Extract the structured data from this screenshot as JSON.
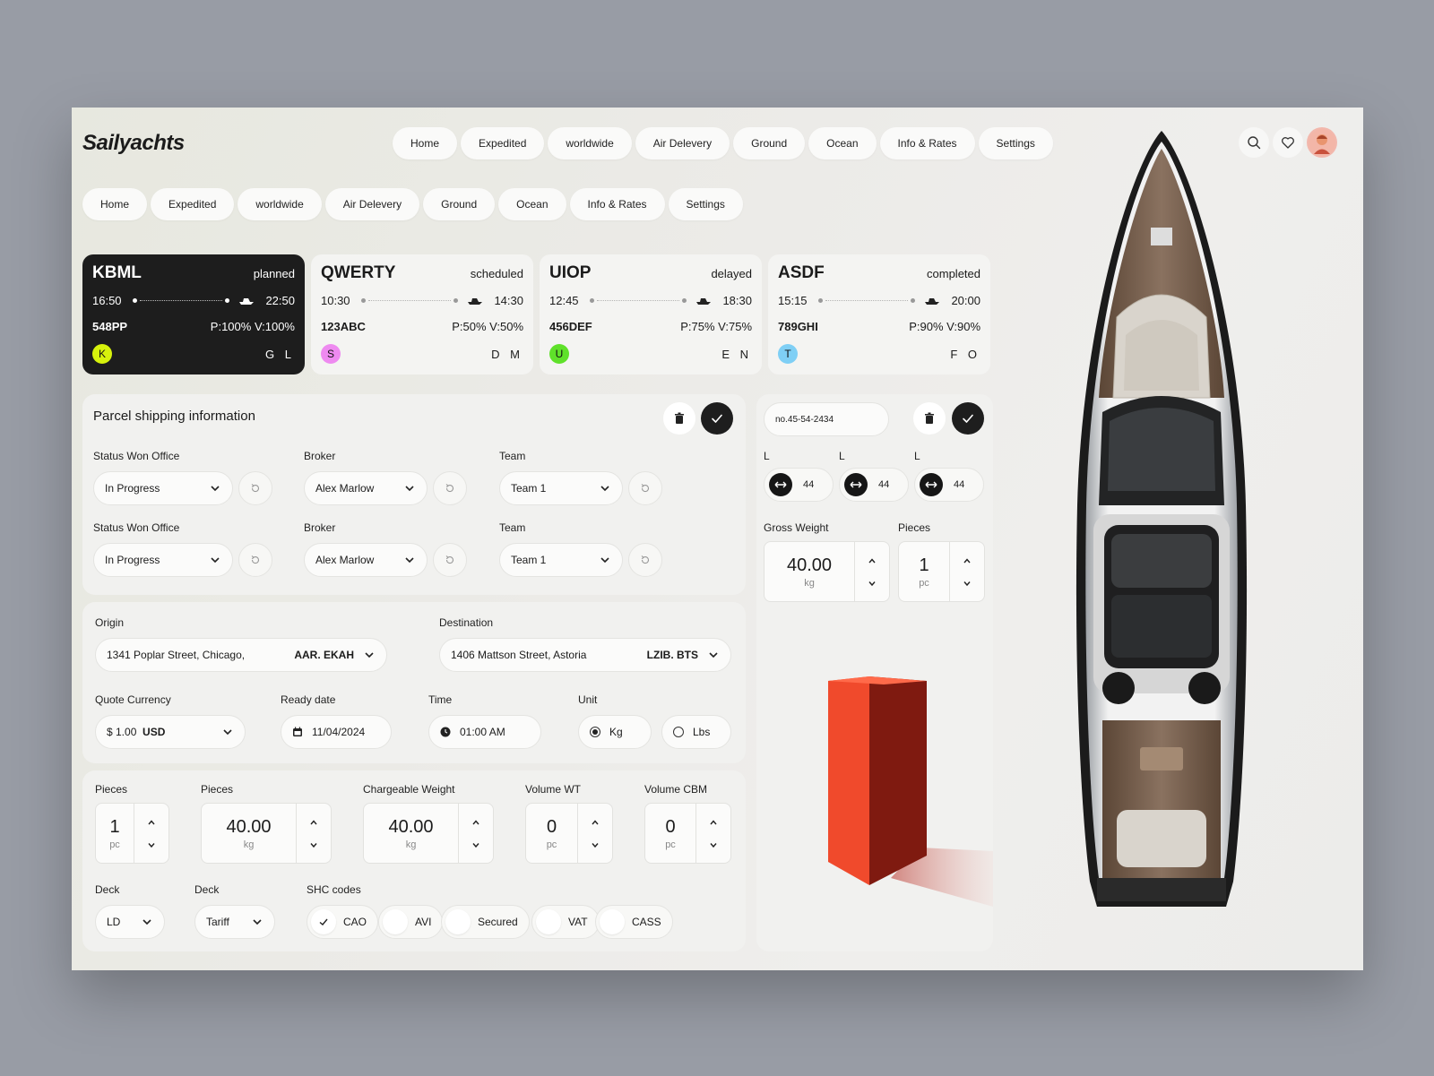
{
  "app": {
    "title": "Sailyachts"
  },
  "nav_top": [
    "Home",
    "Expedited",
    "worldwide",
    "Air Delevery",
    "Ground",
    "Ocean",
    "Info & Rates",
    "Settings"
  ],
  "nav_second": [
    "Home",
    "Expedited",
    "worldwide",
    "Air Delevery",
    "Ground",
    "Ocean",
    "Info & Rates",
    "Settings"
  ],
  "cards": [
    {
      "code": "KBML",
      "status": "planned",
      "dep": "16:50",
      "arr": "22:50",
      "id": "548PP",
      "pv": "P:100%  V:100%",
      "avatar": "K",
      "avatar_color": "#d7f20c",
      "letters": "G L"
    },
    {
      "code": "QWERTY",
      "status": "scheduled",
      "dep": "10:30",
      "arr": "14:30",
      "id": "123ABC",
      "pv": "P:50%  V:50%",
      "avatar": "S",
      "avatar_color": "#ee8af0",
      "letters": "D M"
    },
    {
      "code": "UIOP",
      "status": "delayed",
      "dep": "12:45",
      "arr": "18:30",
      "id": "456DEF",
      "pv": "P:75%  V:75%",
      "avatar": "U",
      "avatar_color": "#5fe12a",
      "letters": "E N"
    },
    {
      "code": "ASDF",
      "status": "completed",
      "dep": "15:15",
      "arr": "20:00",
      "id": "789GHI",
      "pv": "P:90%  V:90%",
      "avatar": "T",
      "avatar_color": "#7fcff5",
      "letters": "F O"
    }
  ],
  "parcel": {
    "title": "Parcel shipping information",
    "rows": [
      {
        "status_label": "Status Won Office",
        "status_value": "In Progress",
        "broker_label": "Broker",
        "broker_value": "Alex Marlow",
        "team_label": "Team",
        "team_value": "Team 1"
      },
      {
        "status_label": "Status Won Office",
        "status_value": "In Progress",
        "broker_label": "Broker",
        "broker_value": "Alex Marlow",
        "team_label": "Team",
        "team_value": "Team 1"
      }
    ]
  },
  "route": {
    "origin_label": "Origin",
    "origin_value": "1341 Poplar Street, Chicago,",
    "origin_code": "AAR. EKAH",
    "dest_label": "Destination",
    "dest_value": "1406 Mattson Street, Astoria",
    "dest_code": "LZIB. BTS",
    "currency_label": "Quote Currency",
    "currency_amount": "$ 1.00",
    "currency_code": "USD",
    "ready_label": "Ready date",
    "ready_value": "11/04/2024",
    "time_label": "Time",
    "time_value": "01:00 AM",
    "unit_label": "Unit",
    "unit_kg": "Kg",
    "unit_lbs": "Lbs"
  },
  "measures": {
    "pieces1_label": "Pieces",
    "pieces1_value": "1",
    "pieces1_unit": "pc",
    "pieces2_label": "Pieces",
    "pieces2_value": "40.00",
    "pieces2_unit": "kg",
    "charge_label": "Chargeable Weight",
    "charge_value": "40.00",
    "charge_unit": "kg",
    "vwt_label": "Volume WT",
    "vwt_value": "0",
    "vwt_unit": "pc",
    "vcbm_label": "Volume CBM",
    "vcbm_value": "0",
    "vcbm_unit": "pc",
    "deck1_label": "Deck",
    "deck1_value": "LD",
    "deck2_label": "Deck",
    "deck2_value": "Tariff",
    "shc_label": "SHC codes",
    "shc": [
      "CAO",
      "AVI",
      "Secured",
      "VAT",
      "CASS"
    ]
  },
  "side": {
    "ref": "no.45-54-2434",
    "dim_labels": [
      "L",
      "L",
      "L"
    ],
    "dim_values": [
      "44",
      "44",
      "44"
    ],
    "gross_label": "Gross Weight",
    "gross_value": "40.00",
    "gross_unit": "kg",
    "pieces_label": "Pieces",
    "pieces_value": "1",
    "pieces_unit": "pc"
  }
}
